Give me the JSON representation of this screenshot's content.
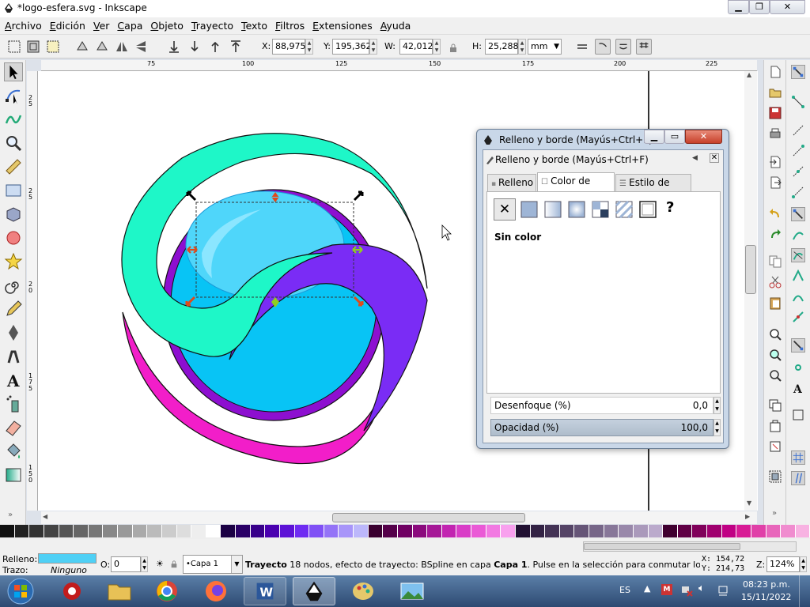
{
  "window": {
    "title": "*logo-esfera.svg - Inkscape"
  },
  "menu": [
    "Archivo",
    "Edición",
    "Ver",
    "Capa",
    "Objeto",
    "Trayecto",
    "Texto",
    "Filtros",
    "Extensiones",
    "Ayuda"
  ],
  "toolbar": {
    "x_label": "X:",
    "x_value": "88,975",
    "y_label": "Y:",
    "y_value": "195,362",
    "w_label": "W:",
    "w_value": "42,012",
    "h_label": "H:",
    "h_value": "25,288",
    "unit": "mm"
  },
  "ruler": {
    "h_ticks": [
      "75",
      "100",
      "125",
      "150",
      "175",
      "200",
      "225"
    ],
    "v_ticks": [
      "2 5",
      "2 5",
      "2 0",
      "1 7 5",
      "1 5 0"
    ]
  },
  "dialog": {
    "title": "Relleno y borde (Mayús+Ctrl+F)",
    "panel_title": "Relleno y borde (Mayús+Ctrl+F)",
    "tabs": [
      "Relleno",
      "Color de trazo",
      "Estilo de trazo"
    ],
    "active_tab": "Color de trazo",
    "paint_label": "Sin color",
    "blur_label": "Desenfoque (%)",
    "blur_value": "0,0",
    "opacity_label": "Opacidad (%)",
    "opacity_value": "100,0"
  },
  "status": {
    "fill_label": "Relleno:",
    "fill_color": "#4fd0f5",
    "stroke_label": "Trazo:",
    "stroke_value": "Ninguno",
    "o_label": "O:",
    "o_value": "0",
    "layer": "•Capa 1",
    "message_bold": "Trayecto",
    "message": " 18 nodos, efecto de trayecto: BSpline en capa ",
    "message_layer": "Capa 1",
    "message_tail": ". Pulse en la selección para conmutar los tira...",
    "cx_label": "X:",
    "cx": "154,72",
    "cy_label": "Y:",
    "cy": "214,73",
    "zoom_label": "Z:",
    "zoom": "124%"
  },
  "taskbar": {
    "lang": "ES",
    "time": "08:23 p.m.",
    "date": "15/11/2022"
  },
  "colors": {
    "accent": "#2d4a72",
    "teal": "#1ef7c8",
    "violet": "#7a2cf5",
    "magenta": "#f21ec9",
    "sphere": "#08c4f5",
    "ring": "#8d0fd0"
  }
}
